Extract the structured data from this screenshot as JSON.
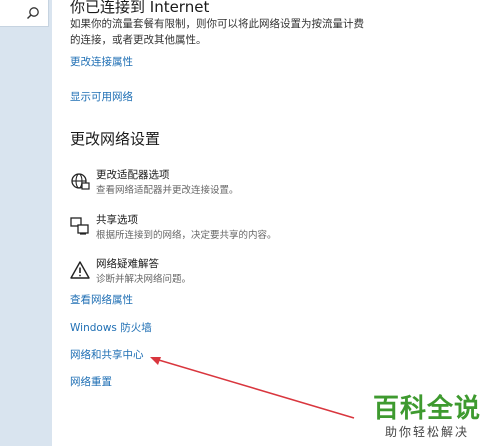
{
  "connection": {
    "title": "你已连接到 Internet",
    "description": "如果你的流量套餐有限制，则你可以将此网络设置为按流量计费的连接，或者更改其他属性。"
  },
  "links": {
    "change_properties": "更改连接属性",
    "show_networks": "显示可用网络"
  },
  "section": {
    "title": "更改网络设置"
  },
  "options": [
    {
      "icon": "network-adapter-icon",
      "title": "更改适配器选项",
      "desc": "查看网络适配器并更改连接设置。"
    },
    {
      "icon": "sharing-icon",
      "title": "共享选项",
      "desc": "根据所连接到的网络，决定要共享的内容。"
    },
    {
      "icon": "warning-icon",
      "title": "网络疑难解答",
      "desc": "诊断并解决网络问题。"
    }
  ],
  "bottom_links": {
    "view_properties": "查看网络属性",
    "firewall": "Windows 防火墙",
    "sharing_center": "网络和共享中心",
    "network_reset": "网络重置"
  },
  "watermark": {
    "main": "百科全说",
    "sub": "助你轻松解决"
  },
  "colors": {
    "link": "#1f6fb4",
    "arrow": "#d9363e",
    "watermark_green": "#3e9a2f",
    "sidebar": "#d9e4ef"
  }
}
